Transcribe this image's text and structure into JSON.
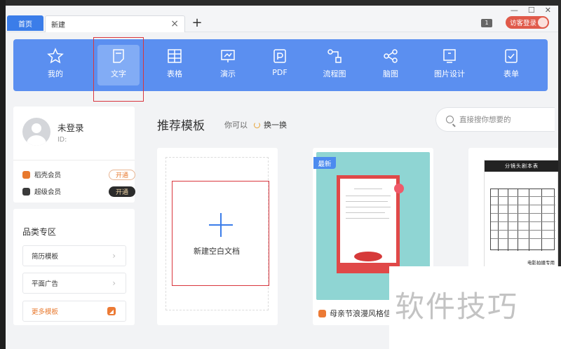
{
  "tabs": {
    "home": "首页",
    "new": "新建"
  },
  "window": {
    "badge_count": "1",
    "guest_login": "访客登录"
  },
  "toolbar": {
    "items": [
      {
        "label": "我的",
        "icon": "star-icon"
      },
      {
        "label": "文字",
        "icon": "document-icon",
        "active": true
      },
      {
        "label": "表格",
        "icon": "table-icon"
      },
      {
        "label": "演示",
        "icon": "presentation-icon"
      },
      {
        "label": "PDF",
        "icon": "pdf-icon"
      },
      {
        "label": "流程图",
        "icon": "flowchart-icon"
      },
      {
        "label": "脑图",
        "icon": "mindmap-icon"
      },
      {
        "label": "图片设计",
        "icon": "image-design-icon"
      },
      {
        "label": "表单",
        "icon": "form-icon"
      }
    ]
  },
  "user": {
    "name": "未登录",
    "id_label": "ID:",
    "vip": [
      {
        "label": "稻壳会员",
        "button": "开通",
        "color": "#e8792e"
      },
      {
        "label": "超级会员",
        "button": "开通",
        "color": "#333333"
      }
    ]
  },
  "categories": {
    "title": "品类专区",
    "items": [
      "简历模板",
      "平面广告",
      "更多模板"
    ]
  },
  "recommend": {
    "title": "推荐模板",
    "hint": "你可以",
    "swap": "换一换",
    "search_placeholder": "直接搜你想要的"
  },
  "templates": {
    "blank_label": "新建空白文档",
    "new_tag": "最新",
    "mom_caption": "母亲节浪漫风格信纸",
    "script_title": "分镜头剧本表",
    "script_footer": "电影拍摄专用"
  },
  "watermark": "软件技巧"
}
